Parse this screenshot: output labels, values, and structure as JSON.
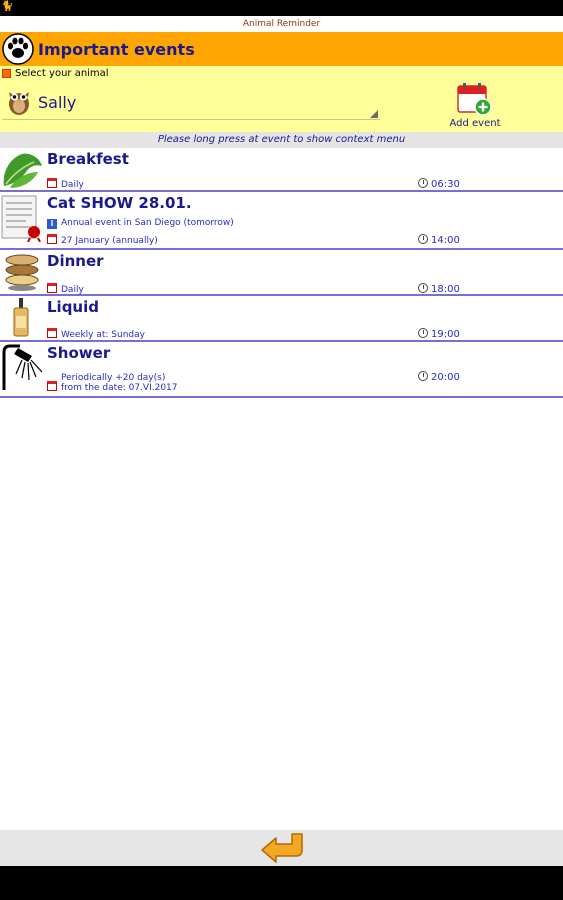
{
  "app": {
    "title": "Animal Reminder"
  },
  "header": {
    "title": "Important events",
    "icon": "paw-icon"
  },
  "animal_select": {
    "label": "Select your animal",
    "value": "Sally",
    "icon": "owl-icon"
  },
  "add_event": {
    "label": "Add event",
    "icon": "calendar-add-icon"
  },
  "hint": "Please long press at event to show context menu",
  "events": [
    {
      "title": "Breakfest",
      "icon": "lettuce-icon",
      "lines": [
        {
          "type": "calendar",
          "text": "Daily"
        }
      ],
      "time": "06:30"
    },
    {
      "title": "Cat SHOW 28.01.",
      "icon": "document-icon",
      "lines": [
        {
          "type": "info",
          "text": "Annual event in San Diego (tomorrow)"
        },
        {
          "type": "calendar",
          "text": "27 January (annually)"
        }
      ],
      "time": "14:00"
    },
    {
      "title": "Dinner",
      "icon": "food-bowls-icon",
      "lines": [
        {
          "type": "calendar",
          "text": "Daily"
        }
      ],
      "time": "18:00"
    },
    {
      "title": "Liquid",
      "icon": "bottle-icon",
      "lines": [
        {
          "type": "calendar",
          "text": "Weekly at: Sunday"
        }
      ],
      "time": "19:00"
    },
    {
      "title": "Shower",
      "icon": "shower-icon",
      "lines": [
        {
          "type": "calendar",
          "text": "Periodically +20 day(s)"
        },
        {
          "type": "calendar-cont",
          "text": "from the date: 07.VI.2017"
        }
      ],
      "time": "20:00"
    }
  ],
  "colors": {
    "header": "#ffa500",
    "panel": "#ffff99",
    "text": "#1a1a8c",
    "divider": "#7a6fd1"
  }
}
